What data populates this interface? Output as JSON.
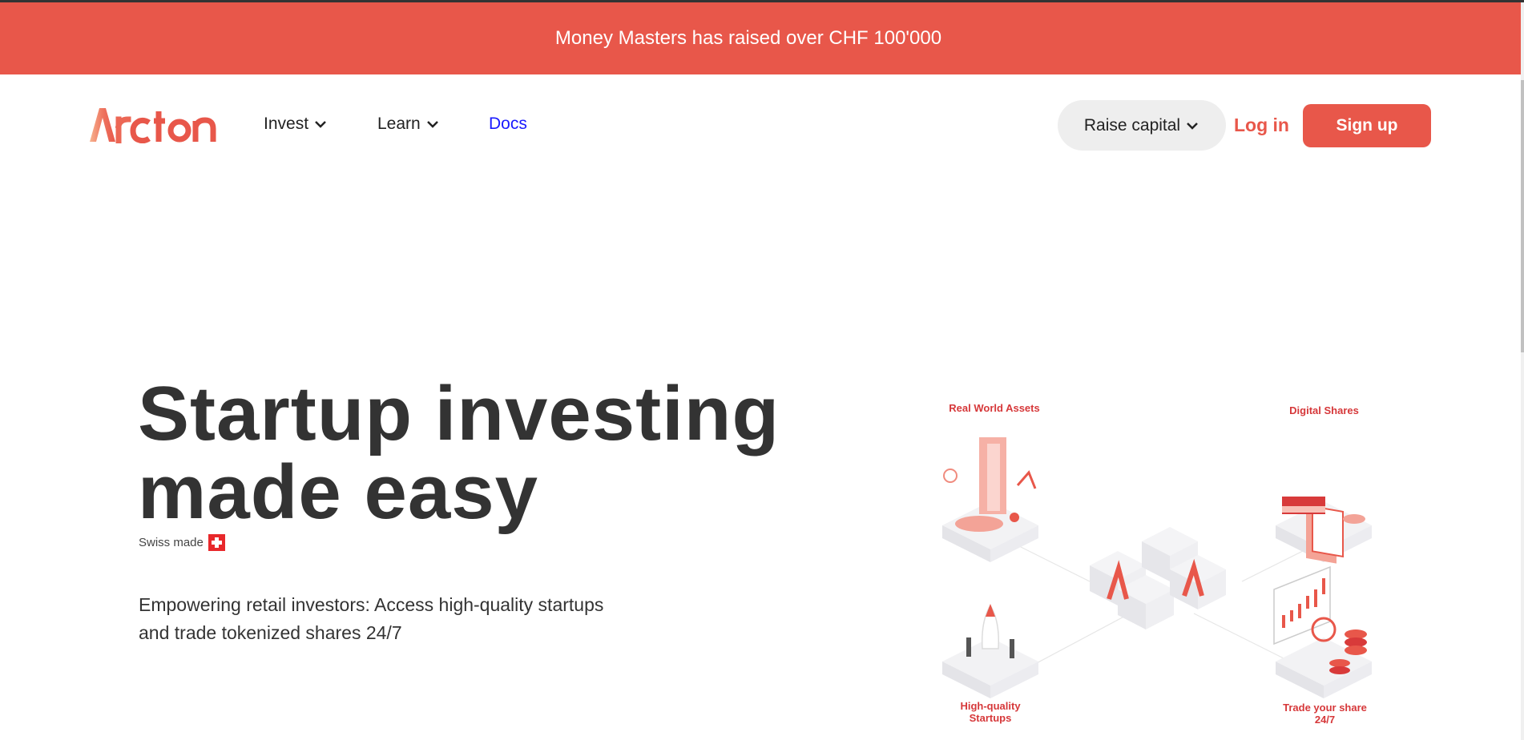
{
  "banner": {
    "text": "Money Masters has raised over CHF 100'000"
  },
  "nav": {
    "logo_text": "Arcton",
    "items": [
      {
        "label": "Invest",
        "icon": "chevron-down-icon"
      },
      {
        "label": "Learn",
        "icon": "chevron-down-icon"
      },
      {
        "label": "Docs"
      }
    ],
    "raise_label": "Raise capital",
    "login_label": "Log in",
    "signup_label": "Sign up"
  },
  "hero": {
    "title_line1": "Startup investing",
    "title_line2": "made easy",
    "swiss_label": "Swiss made",
    "subtitle": "Empowering retail investors: Access high-quality startups and trade tokenized shares 24/7"
  },
  "illustration": {
    "labels": {
      "real_world": "Real World Assets",
      "digital": "Digital Shares",
      "startups_line1": "High-quality",
      "startups_line2": "Startups",
      "trade_line1": "Trade your share",
      "trade_line2": "24/7"
    }
  },
  "colors": {
    "brand": "#e8574a",
    "text_dark": "#333333",
    "link": "#1a1aff"
  }
}
